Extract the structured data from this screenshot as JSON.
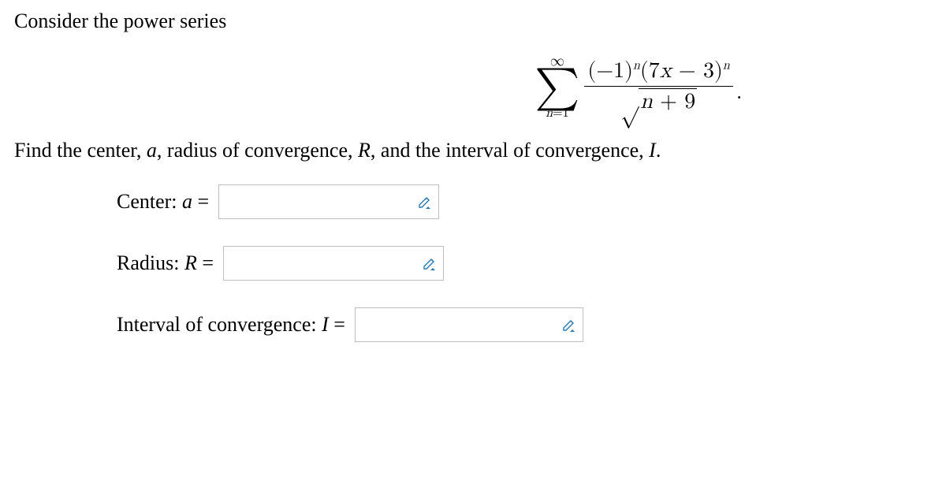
{
  "intro": "Consider the power series",
  "formula": {
    "sigma_top": "∞",
    "sigma_bottom_var": "n",
    "sigma_bottom_eq": "=1",
    "numerator_left": "(−1)",
    "numerator_exp1": "n",
    "numerator_mid": "(7",
    "numerator_x": "x",
    "numerator_right": " − 3)",
    "numerator_exp2": "n",
    "denominator_var": "n",
    "denominator_plus": " + 9",
    "period": "."
  },
  "prompt2_parts": {
    "p1": "Find the center, ",
    "a": "a",
    "p2": ", radius of convergence, ",
    "R": "R",
    "p3": ", and the interval of convergence, ",
    "I": "I",
    "p4": "."
  },
  "fields": {
    "center_label_pre": "Center: ",
    "center_var": "a",
    "center_eq": " =",
    "radius_label_pre": "Radius: ",
    "radius_var": "R",
    "radius_eq": " =",
    "interval_label_pre": "Interval of convergence: ",
    "interval_var": "I",
    "interval_eq": " ="
  },
  "inputs": {
    "center_value": "",
    "radius_value": "",
    "interval_value": ""
  }
}
